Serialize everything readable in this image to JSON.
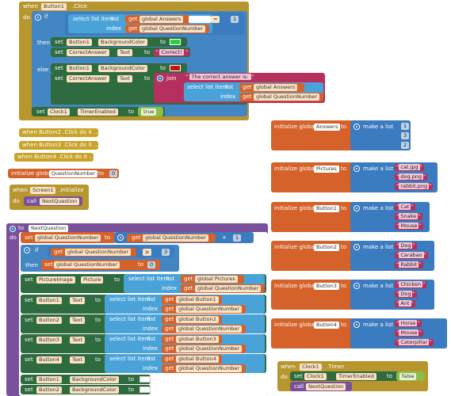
{
  "kw": {
    "when": "when",
    "do": "do",
    "if": "if",
    "then": "then",
    "else": "else",
    "set": "set",
    "to": "to",
    "call": "call",
    "select_list_item": "select list item",
    "list": "list",
    "index": "index",
    "join": "join",
    "initialize_global": "initialize global",
    "make_a_list": "make a list",
    "eq": "=",
    "gte": "≥",
    "plus": "+"
  },
  "blocks": {
    "button1_click": {
      "component": "Button1",
      "event": ".Click"
    },
    "button2_click": "when  Button2 .Click do it ...",
    "button3_click": "when  Button3 .Click do it ...",
    "button4_click": "when  Button4 .Click do it ...",
    "screen1_init": {
      "component": "Screen1",
      "event": ".Initialize"
    },
    "clock1_timer": {
      "component": "Clock1",
      "event": ".Timer"
    },
    "next_question_proc": "NextQuestion"
  },
  "vars": {
    "answers": "global Answers",
    "question_number": "global QuestionNumber",
    "pictures": "global Pictures",
    "button1": "global Button1",
    "button2": "global Button2",
    "button3": "global Button3",
    "button4": "global Button4"
  },
  "props": {
    "background_color": "BackgroundColor",
    "text": "Text",
    "timer_enabled": "TimerEnabled",
    "picture": "Picture"
  },
  "components": {
    "button1": "Button1",
    "button2": "Button2",
    "button3": "Button3",
    "button4": "Button4",
    "correct_answer": "CorrectAnswer",
    "clock1": "Clock1",
    "picture_image": "PictureImage"
  },
  "strings": {
    "correct": "Correct!",
    "correct_answer_is": "The correct answer is: "
  },
  "values": {
    "true": "true",
    "false": "false",
    "one": "1",
    "three": "3",
    "zero": "0",
    "two": "2"
  },
  "inits": {
    "answers": {
      "name": "Answers",
      "items": [
        "1",
        "3",
        "2"
      ]
    },
    "question_number": {
      "name": "QuestionNumber",
      "value": "0"
    },
    "pictures": {
      "name": "Pictures",
      "items": [
        "cat.jpg",
        "dog.png",
        "rabbit.png"
      ]
    },
    "button1": {
      "name": "Button1",
      "items": [
        "Cat",
        "Snake",
        "Mouse"
      ]
    },
    "button2": {
      "name": "Button2",
      "items": [
        "Dog",
        "Carabao",
        "Rabbit"
      ]
    },
    "button3": {
      "name": "Button3",
      "items": [
        "Chicken",
        "Dog",
        "Ant"
      ]
    },
    "button4": {
      "name": "Button4",
      "items": [
        "Horse",
        "Mouse",
        "Caterpillar"
      ]
    }
  },
  "colors": {
    "event": "#b8962e",
    "set": "#2e6b3e",
    "list": "#4aa3d8",
    "var": "#d4622a",
    "proc": "#7a4f9c",
    "text": "#b5305e",
    "logic": "#8cbd44",
    "green": "#2ecc40",
    "red": "#cc1010"
  }
}
